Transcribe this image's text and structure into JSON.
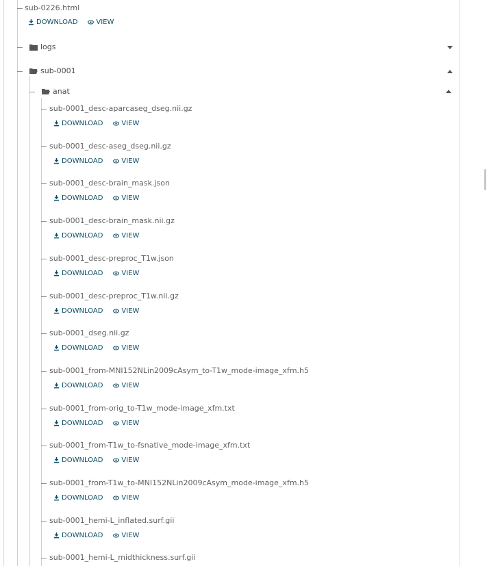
{
  "top_file": {
    "name": "sub-0226.html",
    "download": "DOWNLOAD",
    "view": "VIEW"
  },
  "folders": {
    "logs": "logs",
    "sub0001": "sub-0001",
    "anat": "anat"
  },
  "actions": {
    "download": "DOWNLOAD",
    "view": "VIEW"
  },
  "files": [
    {
      "name": "sub-0001_desc-aparcaseg_dseg.nii.gz"
    },
    {
      "name": "sub-0001_desc-aseg_dseg.nii.gz"
    },
    {
      "name": "sub-0001_desc-brain_mask.json"
    },
    {
      "name": "sub-0001_desc-brain_mask.nii.gz"
    },
    {
      "name": "sub-0001_desc-preproc_T1w.json"
    },
    {
      "name": "sub-0001_desc-preproc_T1w.nii.gz"
    },
    {
      "name": "sub-0001_dseg.nii.gz"
    },
    {
      "name": "sub-0001_from-MNI152NLin2009cAsym_to-T1w_mode-image_xfm.h5"
    },
    {
      "name": "sub-0001_from-orig_to-T1w_mode-image_xfm.txt"
    },
    {
      "name": "sub-0001_from-T1w_to-fsnative_mode-image_xfm.txt"
    },
    {
      "name": "sub-0001_from-T1w_to-MNI152NLin2009cAsym_mode-image_xfm.h5"
    },
    {
      "name": "sub-0001_hemi-L_inflated.surf.gii"
    },
    {
      "name": "sub-0001_hemi-L_midthickness.surf.gii"
    }
  ],
  "colors": {
    "action": "#0e4f67",
    "text": "#616161",
    "line": "#cfcfcf"
  },
  "icons": {
    "download": "download-icon",
    "view": "eye-icon",
    "folder": "folder-icon",
    "folder_open": "folder-open-icon",
    "collapse": "chevron-up-icon",
    "expand": "chevron-down-icon"
  }
}
